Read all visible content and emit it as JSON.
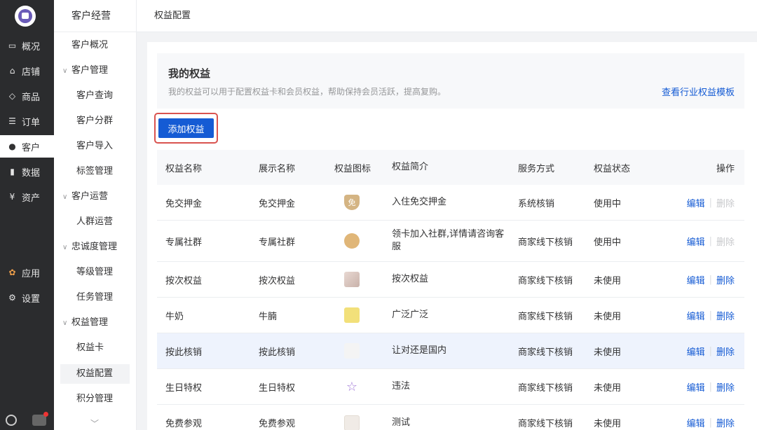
{
  "nav": {
    "items": [
      {
        "label": "概况",
        "icon": "monitor-icon"
      },
      {
        "label": "店铺",
        "icon": "store-icon"
      },
      {
        "label": "商品",
        "icon": "tag-icon"
      },
      {
        "label": "订单",
        "icon": "list-icon"
      },
      {
        "label": "客户",
        "icon": "user-icon",
        "active": true
      },
      {
        "label": "数据",
        "icon": "bar-chart-icon"
      },
      {
        "label": "资产",
        "icon": "yen-icon"
      }
    ],
    "bottom": [
      {
        "label": "应用",
        "icon": "apps-icon"
      },
      {
        "label": "设置",
        "icon": "gear-icon"
      }
    ]
  },
  "sidebar": {
    "title": "客户经营",
    "items": [
      {
        "label": "客户概况"
      },
      {
        "label": "客户管理"
      },
      {
        "label": "客户查询"
      },
      {
        "label": "客户分群"
      },
      {
        "label": "客户导入"
      },
      {
        "label": "标签管理"
      },
      {
        "label": "客户运营"
      },
      {
        "label": "人群运营"
      },
      {
        "label": "忠诚度管理"
      },
      {
        "label": "等级管理"
      },
      {
        "label": "任务管理"
      },
      {
        "label": "权益管理"
      },
      {
        "label": "权益卡"
      },
      {
        "label": "权益配置"
      },
      {
        "label": "积分管理"
      }
    ]
  },
  "topbar": {
    "breadcrumb": "权益配置"
  },
  "intro": {
    "title": "我的权益",
    "desc": "我的权益可以用于配置权益卡和会员权益，帮助保持会员活跃，提高复购。",
    "link": "查看行业权益模板"
  },
  "actions": {
    "add_label": "添加权益"
  },
  "table": {
    "headers": [
      "权益名称",
      "展示名称",
      "权益图标",
      "权益简介",
      "服务方式",
      "权益状态",
      "操作"
    ],
    "rows": [
      {
        "name": "免交押金",
        "display": "免交押金",
        "icon": "shield-badge-icon",
        "intro": "入住免交押金",
        "service": "系统核销",
        "status": "使用中",
        "edit": "编辑",
        "del": "删除",
        "del_enabled": false
      },
      {
        "name": "专属社群",
        "display": "专属社群",
        "icon": "planet-icon",
        "intro": "领卡加入社群,详情请咨询客服",
        "service": "商家线下核销",
        "status": "使用中",
        "edit": "编辑",
        "del": "删除",
        "del_enabled": false
      },
      {
        "name": "按次权益",
        "display": "按次权益",
        "icon": "photo-thumbnail-icon",
        "intro": "按次权益",
        "service": "商家线下核销",
        "status": "未使用",
        "edit": "编辑",
        "del": "删除",
        "del_enabled": true
      },
      {
        "name": "牛奶",
        "display": "牛腩",
        "icon": "yellow-thumbnail-icon",
        "intro": "广泛广泛",
        "service": "商家线下核销",
        "status": "未使用",
        "edit": "编辑",
        "del": "删除",
        "del_enabled": true
      },
      {
        "name": "按此核销",
        "display": "按此核销",
        "icon": "blank-thumbnail-icon",
        "intro": "让对还是国内",
        "service": "商家线下核销",
        "status": "未使用",
        "edit": "编辑",
        "del": "删除",
        "del_enabled": true
      },
      {
        "name": "生日特权",
        "display": "生日特权",
        "icon": "star-icon",
        "intro": "违法",
        "service": "商家线下核销",
        "status": "未使用",
        "edit": "编辑",
        "del": "删除",
        "del_enabled": true
      },
      {
        "name": "免费参观",
        "display": "免费参观",
        "icon": "document-thumbnail-icon",
        "intro": "测试",
        "service": "商家线下核销",
        "status": "未使用",
        "edit": "编辑",
        "del": "删除",
        "del_enabled": true
      }
    ]
  },
  "colors": {
    "primary": "#155bd4",
    "nav_bg": "#2b2c2e",
    "highlight_row": "#eef3fd",
    "focus_outline": "#d9534f"
  }
}
